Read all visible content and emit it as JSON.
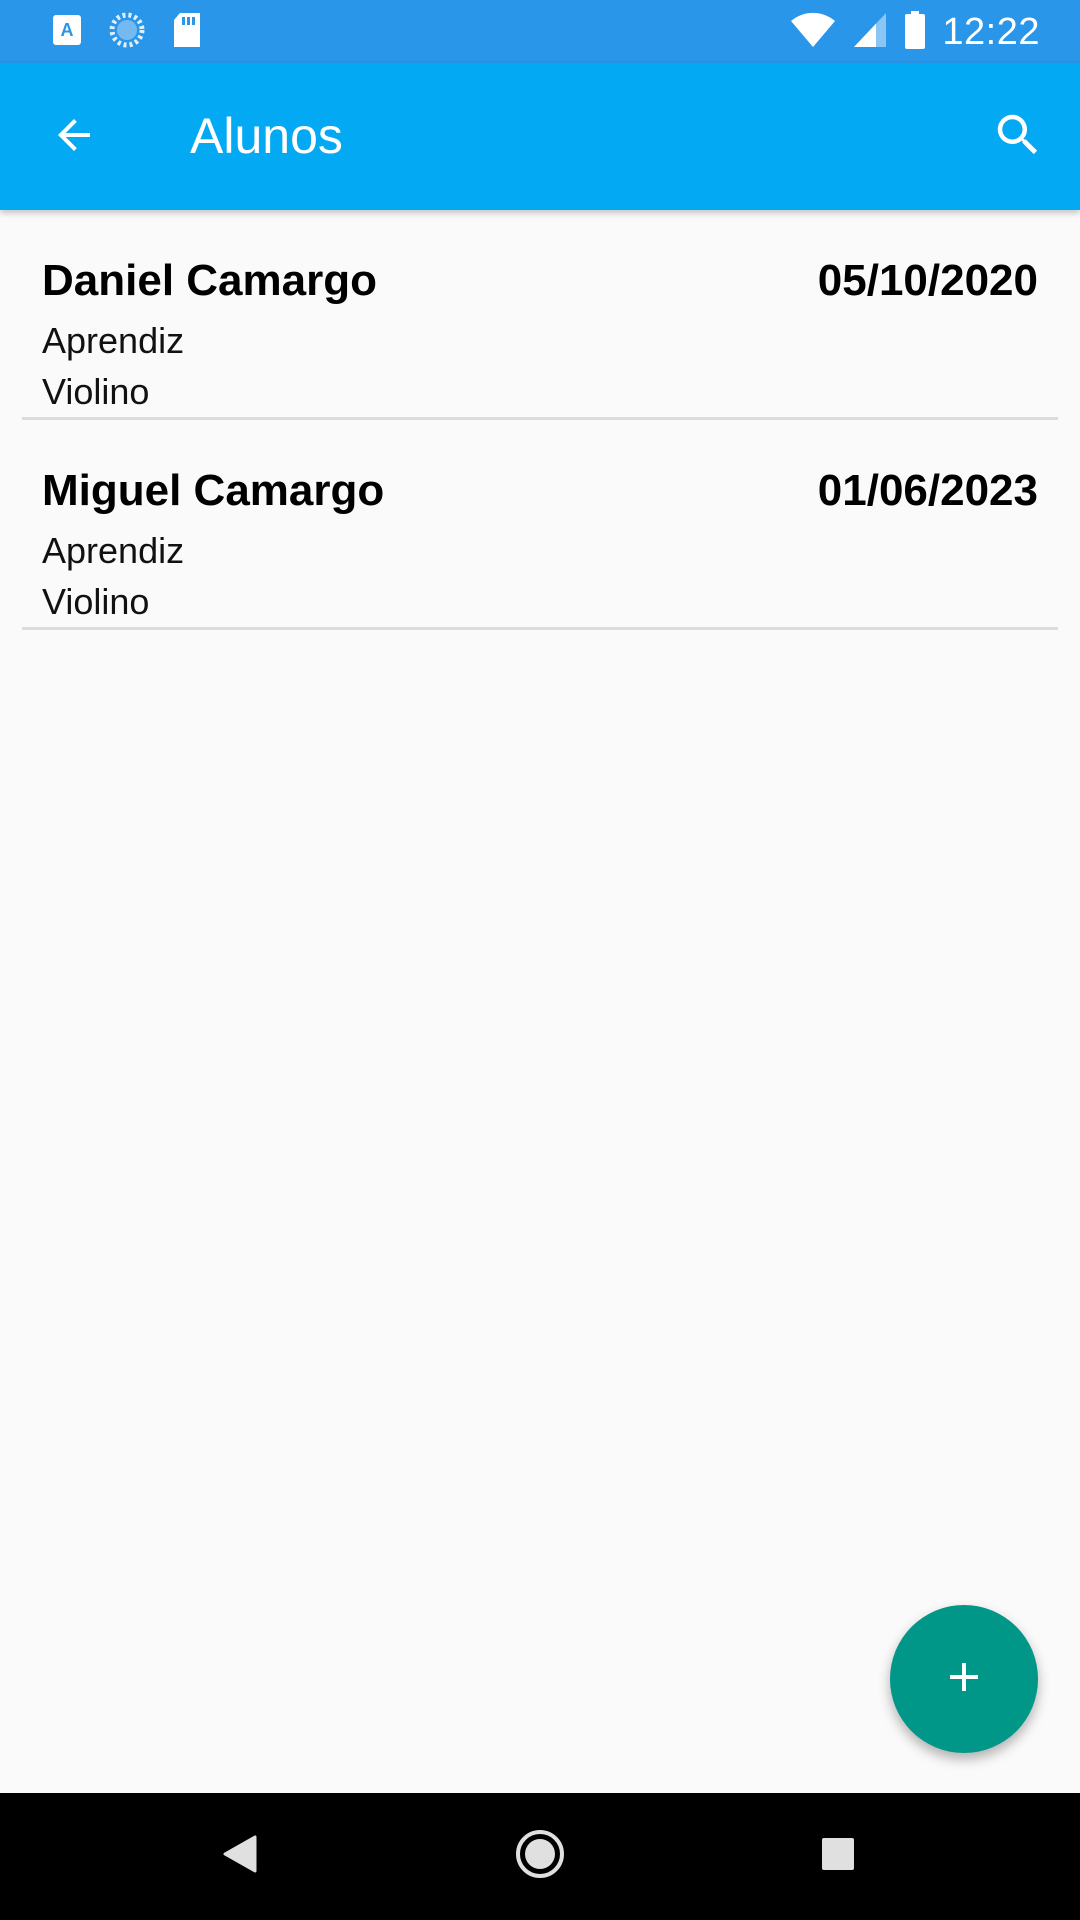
{
  "status_bar": {
    "time": "12:22",
    "icons": [
      "app-a-icon",
      "loading-icon",
      "sd-card-icon",
      "wifi-icon",
      "signal-icon",
      "battery-icon"
    ]
  },
  "app_bar": {
    "title": "Alunos",
    "back_icon": "arrow-back-icon",
    "search_icon": "search-icon",
    "color": "#04a9f3"
  },
  "students": [
    {
      "name": "Daniel Camargo",
      "date": "05/10/2020",
      "level": "Aprendiz",
      "instrument": "Violino"
    },
    {
      "name": "Miguel Camargo",
      "date": "01/06/2023",
      "level": "Aprendiz",
      "instrument": "Violino"
    }
  ],
  "fab": {
    "icon": "plus-icon",
    "color": "#009688"
  },
  "nav_bar": {
    "icons": [
      "back-triangle-icon",
      "home-circle-icon",
      "recents-square-icon"
    ]
  }
}
